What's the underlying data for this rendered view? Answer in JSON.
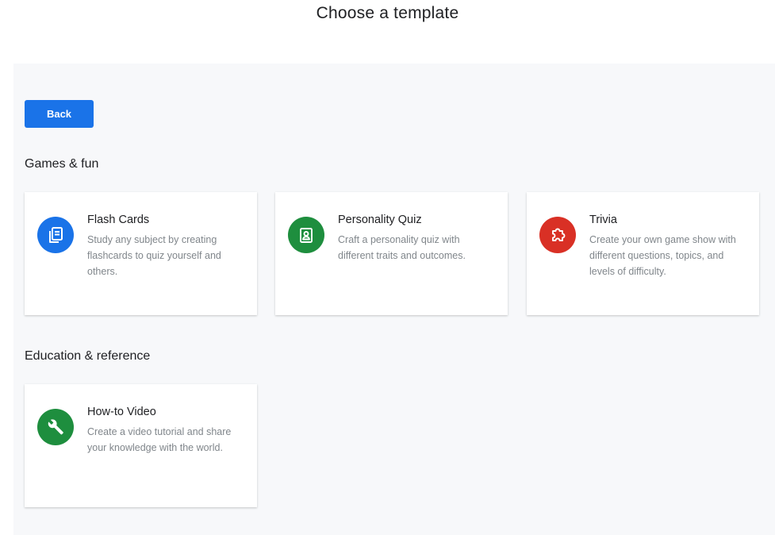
{
  "header": {
    "title": "Choose a template"
  },
  "toolbar": {
    "back_label": "Back"
  },
  "sections": [
    {
      "heading": "Games & fun",
      "cards": [
        {
          "title": "Flash Cards",
          "description": "Study any subject by creating flashcards to quiz yourself and others.",
          "icon": "flashcards-icon",
          "icon_color": "#1a73e8"
        },
        {
          "title": "Personality Quiz",
          "description": "Craft a personality quiz with different traits and outcomes.",
          "icon": "id-badge-icon",
          "icon_color": "#1e8e3e"
        },
        {
          "title": "Trivia",
          "description": "Create your own game show with different questions, topics, and levels of difficulty.",
          "icon": "puzzle-icon",
          "icon_color": "#d93025"
        }
      ]
    },
    {
      "heading": "Education & reference",
      "cards": [
        {
          "title": "How-to Video",
          "description": "Create a video tutorial and share your knowledge with the world.",
          "icon": "wrench-icon",
          "icon_color": "#1e8e3e"
        }
      ]
    }
  ]
}
